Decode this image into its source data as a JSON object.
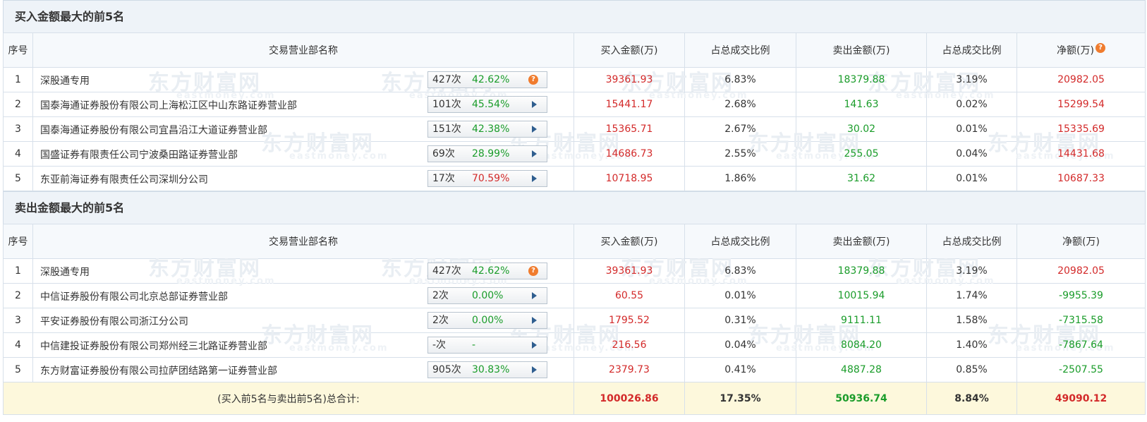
{
  "buy_section": {
    "title": "买入金额最大的前5名",
    "headers": [
      "序号",
      "交易营业部名称",
      "买入金额(万)",
      "占总成交比例",
      "卖出金额(万)",
      "占总成交比例",
      "净额(万)"
    ],
    "rows": [
      {
        "no": "1",
        "name": "深股通专用",
        "count": "427次",
        "pct": "42.62%",
        "pct_color": "green",
        "icon": "question-icon",
        "buy": "39361.93",
        "buy_ratio": "6.83%",
        "sell": "18379.88",
        "sell_ratio": "3.19%",
        "net": "20982.05"
      },
      {
        "no": "2",
        "name": "国泰海通证券股份有限公司上海松江区中山东路证券营业部",
        "count": "101次",
        "pct": "45.54%",
        "pct_color": "green",
        "icon": "arrow-icon",
        "buy": "15441.17",
        "buy_ratio": "2.68%",
        "sell": "141.63",
        "sell_ratio": "0.02%",
        "net": "15299.54"
      },
      {
        "no": "3",
        "name": "国泰海通证券股份有限公司宜昌沿江大道证券营业部",
        "count": "151次",
        "pct": "42.38%",
        "pct_color": "green",
        "icon": "arrow-icon",
        "buy": "15365.71",
        "buy_ratio": "2.67%",
        "sell": "30.02",
        "sell_ratio": "0.01%",
        "net": "15335.69"
      },
      {
        "no": "4",
        "name": "国盛证券有限责任公司宁波桑田路证券营业部",
        "count": "69次",
        "pct": "28.99%",
        "pct_color": "green",
        "icon": "arrow-icon",
        "buy": "14686.73",
        "buy_ratio": "2.55%",
        "sell": "255.05",
        "sell_ratio": "0.04%",
        "net": "14431.68"
      },
      {
        "no": "5",
        "name": "东亚前海证券有限责任公司深圳分公司",
        "count": "17次",
        "pct": "70.59%",
        "pct_color": "red",
        "icon": "arrow-icon",
        "buy": "10718.95",
        "buy_ratio": "1.86%",
        "sell": "31.62",
        "sell_ratio": "0.01%",
        "net": "10687.33"
      }
    ]
  },
  "sell_section": {
    "title": "卖出金额最大的前5名",
    "headers": [
      "序号",
      "交易营业部名称",
      "买入金额(万)",
      "占总成交比例",
      "卖出金额(万)",
      "占总成交比例",
      "净额(万)"
    ],
    "rows": [
      {
        "no": "1",
        "name": "深股通专用",
        "count": "427次",
        "pct": "42.62%",
        "pct_color": "green",
        "icon": "question-icon",
        "buy": "39361.93",
        "buy_ratio": "6.83%",
        "sell": "18379.88",
        "sell_ratio": "3.19%",
        "net": "20982.05"
      },
      {
        "no": "2",
        "name": "中信证券股份有限公司北京总部证券营业部",
        "count": "2次",
        "pct": "0.00%",
        "pct_color": "green",
        "icon": "arrow-icon",
        "buy": "60.55",
        "buy_ratio": "0.01%",
        "sell": "10015.94",
        "sell_ratio": "1.74%",
        "net": "-9955.39"
      },
      {
        "no": "3",
        "name": "平安证券股份有限公司浙江分公司",
        "count": "2次",
        "pct": "0.00%",
        "pct_color": "green",
        "icon": "arrow-icon",
        "buy": "1795.52",
        "buy_ratio": "0.31%",
        "sell": "9111.11",
        "sell_ratio": "1.58%",
        "net": "-7315.58"
      },
      {
        "no": "4",
        "name": "中信建投证券股份有限公司郑州经三北路证券营业部",
        "count": "-次",
        "pct": "-",
        "pct_color": "green",
        "icon": "arrow-icon",
        "buy": "216.56",
        "buy_ratio": "0.04%",
        "sell": "8084.20",
        "sell_ratio": "1.40%",
        "net": "-7867.64"
      },
      {
        "no": "5",
        "name": "东方财富证券股份有限公司拉萨团结路第一证券营业部",
        "count": "905次",
        "pct": "30.83%",
        "pct_color": "green",
        "icon": "arrow-icon",
        "buy": "2379.73",
        "buy_ratio": "0.41%",
        "sell": "4887.28",
        "sell_ratio": "0.85%",
        "net": "-2507.55"
      }
    ]
  },
  "total": {
    "label": "(买入前5名与卖出前5名)总合计:",
    "buy": "100026.86",
    "buy_ratio": "17.35%",
    "sell": "50936.74",
    "sell_ratio": "8.84%",
    "net": "49090.12"
  },
  "watermark": {
    "text": "东方财富网",
    "sub": "eastmoney.com"
  },
  "colors": {
    "buy": "#d32a2a",
    "sell": "#1a9c2a",
    "header_bg": "#eef3f8",
    "total_bg": "#fdf8dc",
    "icon_orange": "#f07c2e",
    "arrow_blue": "#2f5e8f"
  }
}
